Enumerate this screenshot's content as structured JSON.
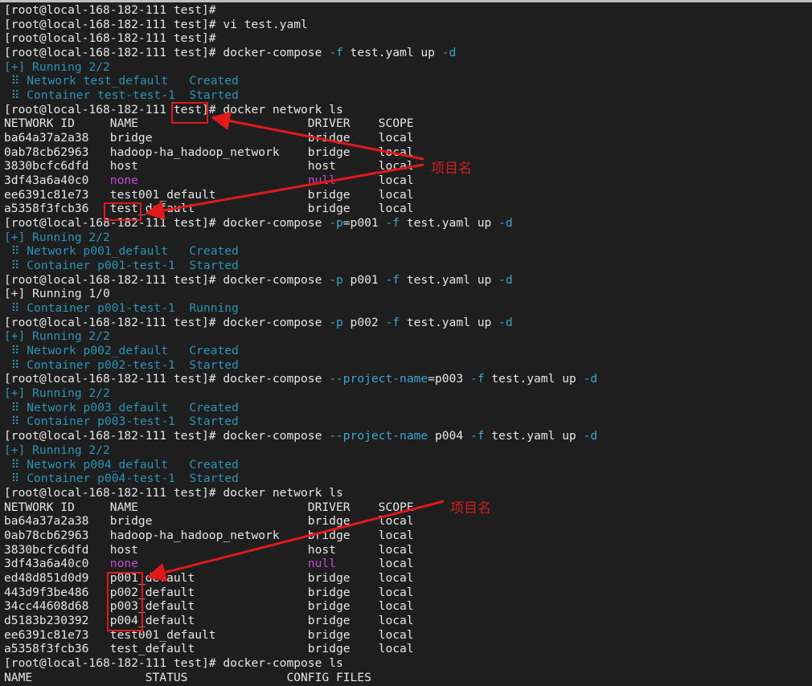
{
  "prompt": "[root@local-168-182-111 test]# ",
  "lines": [
    {
      "segs": [
        {
          "t": "[root@local-168-182-111 test]#",
          "c": "w"
        }
      ]
    },
    {
      "segs": [
        {
          "t": "[root@local-168-182-111 test]# vi test.yaml",
          "c": "w"
        }
      ]
    },
    {
      "segs": [
        {
          "t": "[root@local-168-182-111 test]#",
          "c": "w"
        }
      ]
    },
    {
      "segs": [
        {
          "t": "[root@local-168-182-111 test]# docker-compose ",
          "c": "w"
        },
        {
          "t": "-f",
          "c": "f"
        },
        {
          "t": " test.yaml up ",
          "c": "w"
        },
        {
          "t": "-d",
          "c": "f"
        }
      ]
    },
    {
      "segs": [
        {
          "t": "[+] Running 2/2",
          "c": "c"
        }
      ]
    },
    {
      "segs": [
        {
          "t": " ⠿ Network test_default   Created",
          "c": "c"
        }
      ]
    },
    {
      "segs": [
        {
          "t": " ⠿ Container test-test-1  Started",
          "c": "c"
        }
      ]
    },
    {
      "segs": [
        {
          "t": "[root@local-168-182-111 test]# docker network ls",
          "c": "w"
        }
      ]
    },
    {
      "segs": [
        {
          "t": "NETWORK ID     NAME                        DRIVER    SCOPE",
          "c": "w"
        }
      ]
    },
    {
      "segs": [
        {
          "t": "ba64a37a2a38   bridge                      bridge    local",
          "c": "w"
        }
      ]
    },
    {
      "segs": [
        {
          "t": "0ab78cb62963   hadoop-ha_hadoop_network    bridge    local",
          "c": "w"
        }
      ]
    },
    {
      "segs": [
        {
          "t": "3830bcfc6dfd   host                        host      local",
          "c": "w"
        }
      ]
    },
    {
      "segs": [
        {
          "t": "3df43a6a40c0   ",
          "c": "w"
        },
        {
          "t": "none",
          "c": "m"
        },
        {
          "t": "                        ",
          "c": "w"
        },
        {
          "t": "null",
          "c": "m"
        },
        {
          "t": "      local",
          "c": "w"
        }
      ]
    },
    {
      "segs": [
        {
          "t": "ee6391c81e73   test001_default             bridge    local",
          "c": "w"
        }
      ]
    },
    {
      "segs": [
        {
          "t": "a5358f3fcb36   test_default                bridge    local",
          "c": "w"
        }
      ]
    },
    {
      "segs": [
        {
          "t": "[root@local-168-182-111 test]# docker-compose ",
          "c": "w"
        },
        {
          "t": "-p",
          "c": "f"
        },
        {
          "t": "=p001 ",
          "c": "w"
        },
        {
          "t": "-f",
          "c": "f"
        },
        {
          "t": " test.yaml up ",
          "c": "w"
        },
        {
          "t": "-d",
          "c": "f"
        }
      ]
    },
    {
      "segs": [
        {
          "t": "[+] Running 2/2",
          "c": "c"
        }
      ]
    },
    {
      "segs": [
        {
          "t": " ⠿ Network p001_default   Created",
          "c": "c"
        }
      ]
    },
    {
      "segs": [
        {
          "t": " ⠿ Container p001-test-1  Started",
          "c": "c"
        }
      ]
    },
    {
      "segs": [
        {
          "t": "[root@local-168-182-111 test]# docker-compose ",
          "c": "w"
        },
        {
          "t": "-p",
          "c": "f"
        },
        {
          "t": " p001 ",
          "c": "w"
        },
        {
          "t": "-f",
          "c": "f"
        },
        {
          "t": " test.yaml up ",
          "c": "w"
        },
        {
          "t": "-d",
          "c": "f"
        }
      ]
    },
    {
      "segs": [
        {
          "t": "[+] Running 1/0",
          "c": "w"
        }
      ]
    },
    {
      "segs": [
        {
          "t": " ⠿ Container p001-test-1  Running",
          "c": "c"
        }
      ]
    },
    {
      "segs": [
        {
          "t": "[root@local-168-182-111 test]# docker-compose ",
          "c": "w"
        },
        {
          "t": "-p",
          "c": "f"
        },
        {
          "t": " p002 ",
          "c": "w"
        },
        {
          "t": "-f",
          "c": "f"
        },
        {
          "t": " test.yaml up ",
          "c": "w"
        },
        {
          "t": "-d",
          "c": "f"
        }
      ]
    },
    {
      "segs": [
        {
          "t": "[+] Running 2/2",
          "c": "c"
        }
      ]
    },
    {
      "segs": [
        {
          "t": " ⠿ Network p002_default   Created",
          "c": "c"
        }
      ]
    },
    {
      "segs": [
        {
          "t": " ⠿ Container p002-test-1  Started",
          "c": "c"
        }
      ]
    },
    {
      "segs": [
        {
          "t": "[root@local-168-182-111 test]# docker-compose ",
          "c": "w"
        },
        {
          "t": "--project-name",
          "c": "f"
        },
        {
          "t": "=p003 ",
          "c": "w"
        },
        {
          "t": "-f",
          "c": "f"
        },
        {
          "t": " test.yaml up ",
          "c": "w"
        },
        {
          "t": "-d",
          "c": "f"
        }
      ]
    },
    {
      "segs": [
        {
          "t": "[+] Running 2/2",
          "c": "c"
        }
      ]
    },
    {
      "segs": [
        {
          "t": " ⠿ Network p003_default   Created",
          "c": "c"
        }
      ]
    },
    {
      "segs": [
        {
          "t": " ⠿ Container p003-test-1  Started",
          "c": "c"
        }
      ]
    },
    {
      "segs": [
        {
          "t": "[root@local-168-182-111 test]# docker-compose ",
          "c": "w"
        },
        {
          "t": "--project-name",
          "c": "f"
        },
        {
          "t": " p004 ",
          "c": "w"
        },
        {
          "t": "-f",
          "c": "f"
        },
        {
          "t": " test.yaml up ",
          "c": "w"
        },
        {
          "t": "-d",
          "c": "f"
        }
      ]
    },
    {
      "segs": [
        {
          "t": "[+] Running 2/2",
          "c": "c"
        }
      ]
    },
    {
      "segs": [
        {
          "t": " ⠿ Network p004_default   Created",
          "c": "c"
        }
      ]
    },
    {
      "segs": [
        {
          "t": " ⠿ Container p004-test-1  Started",
          "c": "c"
        }
      ]
    },
    {
      "segs": [
        {
          "t": "[root@local-168-182-111 test]# docker network ls",
          "c": "w"
        }
      ]
    },
    {
      "segs": [
        {
          "t": "NETWORK ID     NAME                        DRIVER    SCOPE",
          "c": "w"
        }
      ]
    },
    {
      "segs": [
        {
          "t": "ba64a37a2a38   bridge                      bridge    local",
          "c": "w"
        }
      ]
    },
    {
      "segs": [
        {
          "t": "0ab78cb62963   hadoop-ha_hadoop_network    bridge    local",
          "c": "w"
        }
      ]
    },
    {
      "segs": [
        {
          "t": "3830bcfc6dfd   host                        host      local",
          "c": "w"
        }
      ]
    },
    {
      "segs": [
        {
          "t": "3df43a6a40c0   ",
          "c": "w"
        },
        {
          "t": "none",
          "c": "m"
        },
        {
          "t": "                        ",
          "c": "w"
        },
        {
          "t": "null",
          "c": "m"
        },
        {
          "t": "      local",
          "c": "w"
        }
      ]
    },
    {
      "segs": [
        {
          "t": "ed48d851d0d9   p001_default                bridge    local",
          "c": "w"
        }
      ]
    },
    {
      "segs": [
        {
          "t": "443d9f3be486   p002_default                bridge    local",
          "c": "w"
        }
      ]
    },
    {
      "segs": [
        {
          "t": "34cc44608d68   p003_default                bridge    local",
          "c": "w"
        }
      ]
    },
    {
      "segs": [
        {
          "t": "d5183b230392   p004_default                bridge    local",
          "c": "w"
        }
      ]
    },
    {
      "segs": [
        {
          "t": "ee6391c81e73   test001_default             bridge    local",
          "c": "w"
        }
      ]
    },
    {
      "segs": [
        {
          "t": "a5358f3fcb36   test_default                bridge    local",
          "c": "w"
        }
      ]
    },
    {
      "segs": [
        {
          "t": "[root@local-168-182-111 test]# docker-compose ls",
          "c": "w"
        }
      ]
    },
    {
      "segs": [
        {
          "t": "NAME                STATUS              CONFIG FILES",
          "c": "w"
        }
      ]
    }
  ],
  "annotations": {
    "label_1": "项目名",
    "label_2": "项目名",
    "color": "#e0191b"
  },
  "colors": {
    "background": "#1e1e1e",
    "text": "#e6e6e6",
    "cyan": "#2c94b8",
    "magenta": "#c04ed6"
  }
}
